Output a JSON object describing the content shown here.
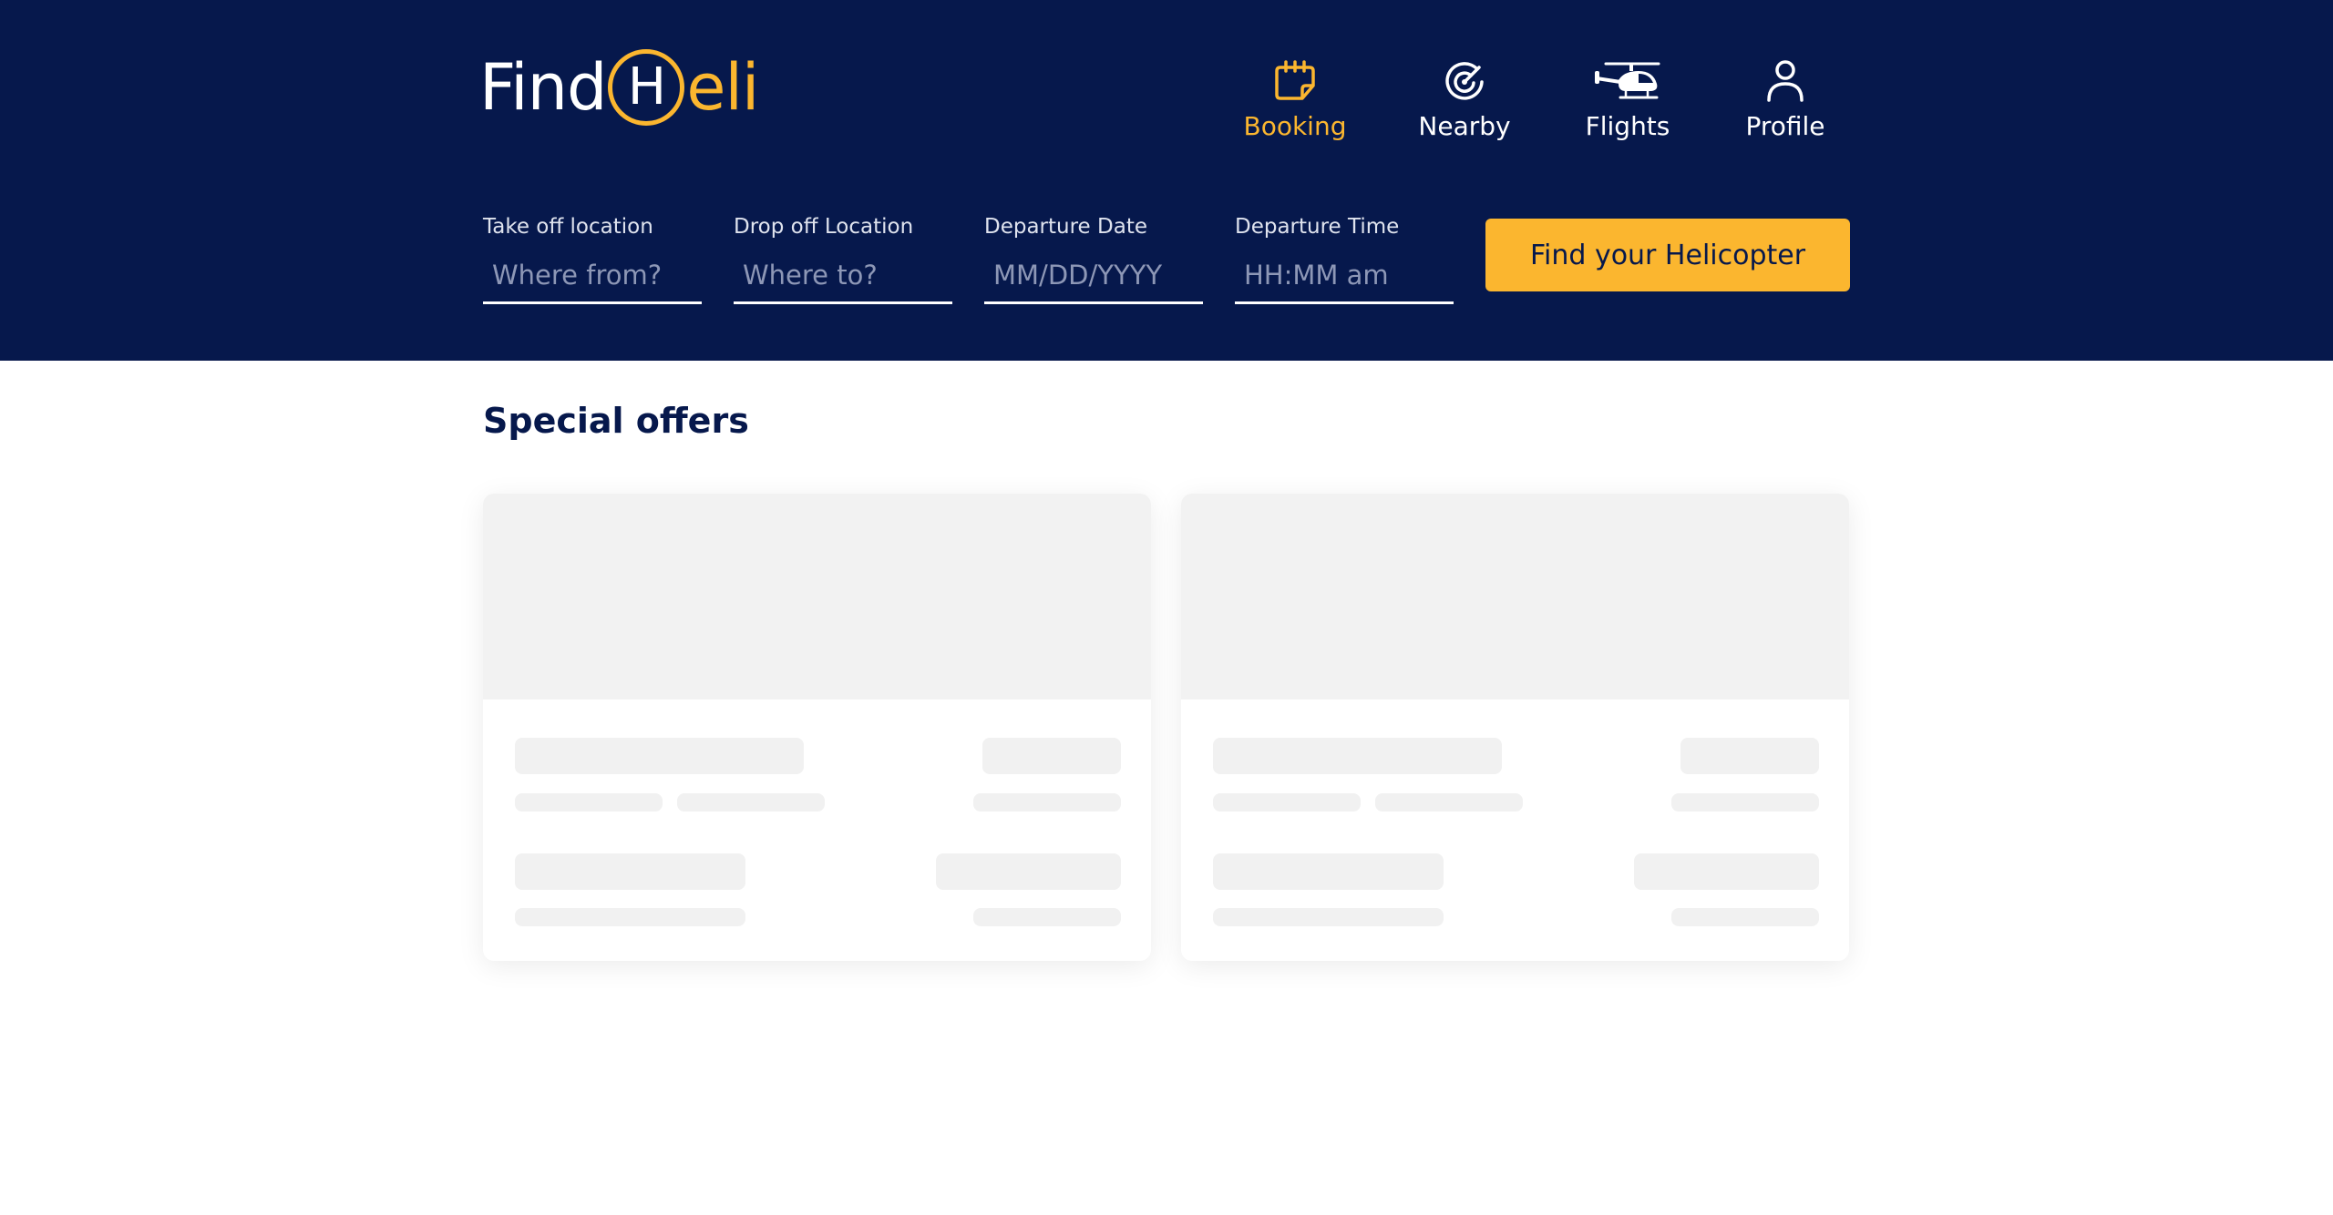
{
  "brand": {
    "logo_prefix": "Find",
    "logo_circle": "H",
    "logo_suffix": "eli",
    "accent_color": "#fbb62f",
    "header_color": "#06184c"
  },
  "nav": [
    {
      "label": "Booking",
      "icon": "calendar-icon",
      "active": true
    },
    {
      "label": "Nearby",
      "icon": "radar-icon",
      "active": false
    },
    {
      "label": "Flights",
      "icon": "helicopter-icon",
      "active": false
    },
    {
      "label": "Profile",
      "icon": "user-icon",
      "active": false
    }
  ],
  "search": {
    "takeoff": {
      "label": "Take off location",
      "placeholder": "Where from?"
    },
    "dropoff": {
      "label": "Drop off Location",
      "placeholder": "Where to?"
    },
    "date": {
      "label": "Departure Date",
      "placeholder": "MM/DD/YYYY"
    },
    "time": {
      "label": "Departure Time",
      "placeholder": "HH:MM am"
    },
    "button_label": "Find your Helicopter"
  },
  "offers": {
    "title": "Special offers",
    "cards_loading": 2
  }
}
